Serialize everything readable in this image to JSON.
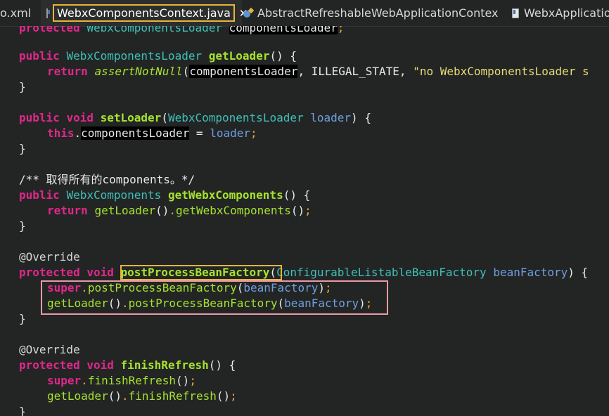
{
  "tabs": [
    {
      "label": "o.xml"
    },
    {
      "label": "WebxComponentsContext.java",
      "close": "✕"
    },
    {
      "label": "AbstractRefreshableWebApplicationContex"
    },
    {
      "label": "WebxApplication"
    }
  ],
  "code": {
    "l0": [
      "protected ",
      "WebxComponentsLoader ",
      "componentsLoader",
      ";"
    ],
    "l1": [
      "public ",
      "WebxComponentsLoader ",
      "getLoader",
      "() {"
    ],
    "l2": [
      "return ",
      "assertNotNull",
      "(",
      "componentsLoader",
      ", ILLEGAL_STATE, ",
      "\"no WebxComponentsLoader s"
    ],
    "l3": [
      "}"
    ],
    "l4": [
      "public ",
      "void ",
      "setLoader",
      "(",
      "WebxComponentsLoader ",
      "loader",
      ") {"
    ],
    "l5": [
      "this",
      ".",
      "componentsLoader",
      " = ",
      "loader",
      ";"
    ],
    "l6": [
      "}"
    ],
    "l7": [
      "/** 取得所有的components。*/"
    ],
    "l8": [
      "public ",
      "WebxComponents ",
      "getWebxComponents",
      "() {"
    ],
    "l9": [
      "return ",
      "getLoader",
      "()",
      ".",
      "getWebxComponents",
      "()",
      ";"
    ],
    "l10": [
      "}"
    ],
    "l11": [
      "@Override"
    ],
    "l12": [
      "protected ",
      "void ",
      "postProcessBeanFactory",
      "(",
      "ConfigurableListableBeanFactory ",
      "beanFactory",
      ") {"
    ],
    "l13": [
      "super",
      ".",
      "postProcessBeanFactory",
      "(",
      "beanFactory",
      ")",
      ";"
    ],
    "l14": [
      "getLoader",
      "()",
      ".",
      "postProcessBeanFactory",
      "(",
      "beanFactory",
      ")",
      ";"
    ],
    "l15": [
      "}"
    ],
    "l16": [
      "@Override"
    ],
    "l17": [
      "protected ",
      "void ",
      "finishRefresh",
      "() {"
    ],
    "l18": [
      "super",
      ".",
      "finishRefresh",
      "()",
      ";"
    ],
    "l19": [
      "getLoader",
      "()",
      ".",
      "finishRefresh",
      "()",
      ";"
    ],
    "l20": [
      "}"
    ]
  }
}
